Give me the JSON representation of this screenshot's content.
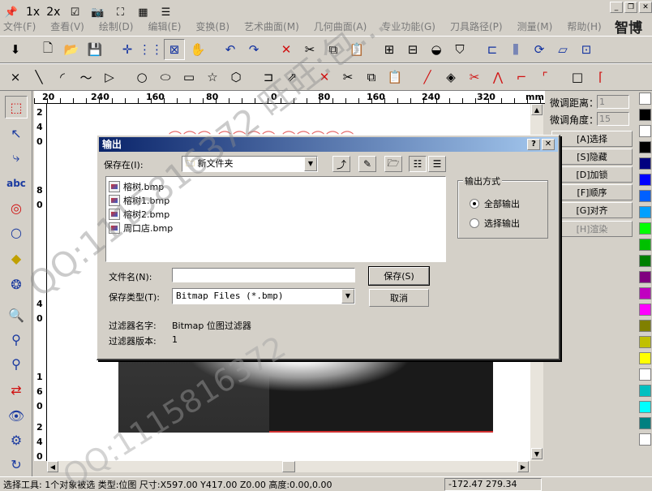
{
  "app": {
    "brand": "智博",
    "quick": {
      "zoom_1x": "1x",
      "zoom_2x": "2x"
    },
    "menu": [
      "文件(F)",
      "查看(V)",
      "绘制(D)",
      "编辑(E)",
      "变换(B)",
      "艺术曲面(M)",
      "几何曲面(A)",
      "专业功能(G)",
      "刀具路径(P)",
      "测量(M)",
      "帮助(H)"
    ]
  },
  "rulers": {
    "h": [
      "20",
      "240",
      "160",
      "80",
      "0",
      "80",
      "160",
      "240",
      "320",
      "mm"
    ],
    "v": [
      "2",
      "4",
      "0",
      "8",
      "0",
      "4",
      "0",
      "1",
      "6",
      "0",
      "2",
      "4",
      "0"
    ]
  },
  "canvas": {
    "red_text": "⌒⌒⌒ ⌒⌒⌒⌒ ⌒⌒⌒⌒⌒"
  },
  "right_panel": {
    "fine_distance_label": "微调距离：",
    "fine_distance_value": "1",
    "fine_angle_label": "微调角度：",
    "fine_angle_value": "15",
    "buttons": [
      "[A]选择",
      "[S]隐藏",
      "[D]加锁",
      "[F]顺序",
      "[G]对齐",
      "[H]渲染"
    ]
  },
  "palette": [
    "#ffffff",
    "#000000",
    "#ffffff",
    "#000000",
    "#000080",
    "#0000ff",
    "#0060ff",
    "#00a0ff",
    "#00ff00",
    "#00c000",
    "#008000",
    "#800080",
    "#c000c0",
    "#ff00ff",
    "#808000",
    "#c0c000",
    "#ffff00",
    "#ffffff",
    "#00c0c0",
    "#00ffff",
    "#008080",
    "#ffffff"
  ],
  "status": {
    "left": "选择工具: 1个对象被选 类型:位图 尺寸:X597.00 Y417.00 Z0.00 高度:0.00,0.00",
    "coords": "-172.47 279.34"
  },
  "watermark": "QQ:1115816372  旺旺:包…",
  "watermark2": "QQ:1115816372",
  "dialog": {
    "title": "输出",
    "save_in_label": "保存在(I):",
    "folder": "新文件夹",
    "files": [
      "榕树.bmp",
      "榕树1.bmp",
      "榕树2.bmp",
      "周口店.bmp"
    ],
    "output_mode_label": "输出方式",
    "radio_all": "全部输出",
    "radio_selected": "选择输出",
    "filename_label": "文件名(N):",
    "filename_value": "",
    "filetype_label": "保存类型(T):",
    "filetype_value": "Bitmap Files (*.bmp)",
    "save_button": "保存(S)",
    "cancel_button": "取消",
    "filter_name_label": "过滤器名字:",
    "filter_name_value": "Bitmap 位图过滤器",
    "filter_version_label": "过滤器版本:",
    "filter_version_value": "1"
  }
}
